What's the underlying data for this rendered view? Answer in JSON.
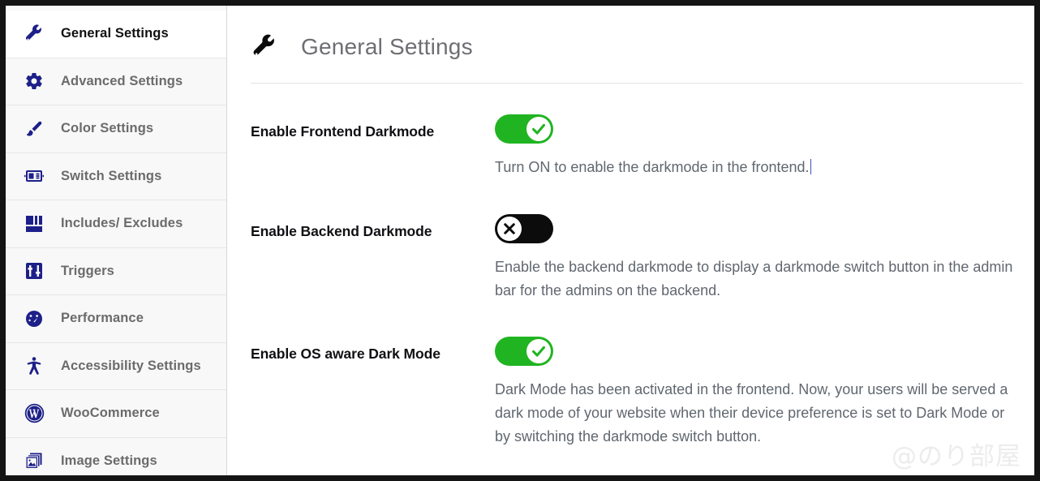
{
  "sidebar": {
    "items": [
      {
        "label": "General Settings",
        "icon": "wrench-icon",
        "active": true
      },
      {
        "label": "Advanced Settings",
        "icon": "gear-icon",
        "active": false
      },
      {
        "label": "Color Settings",
        "icon": "paintbrush-icon",
        "active": false
      },
      {
        "label": "Switch Settings",
        "icon": "switch-icon",
        "active": false
      },
      {
        "label": "Includes/ Excludes",
        "icon": "layout-blocks-icon",
        "active": false
      },
      {
        "label": "Triggers",
        "icon": "sliders-icon",
        "active": false
      },
      {
        "label": "Performance",
        "icon": "gauge-icon",
        "active": false
      },
      {
        "label": "Accessibility Settings",
        "icon": "accessibility-icon",
        "active": false
      },
      {
        "label": "WooCommerce",
        "icon": "wordpress-icon",
        "active": false
      },
      {
        "label": "Image Settings",
        "icon": "images-icon",
        "active": false
      }
    ]
  },
  "header": {
    "icon": "wrench-icon",
    "title": "General Settings"
  },
  "fields": [
    {
      "label": "Enable Frontend Darkmode",
      "toggle_state": "on",
      "toggle_glyph": "check-icon",
      "description": "Turn ON to enable the darkmode in the frontend.",
      "has_caret": true
    },
    {
      "label": "Enable Backend Darkmode",
      "toggle_state": "off",
      "toggle_glyph": "cross-icon",
      "description": "Enable the backend darkmode to display a darkmode switch button in the admin bar for the admins on the backend.",
      "has_caret": false
    },
    {
      "label": "Enable OS aware Dark Mode",
      "toggle_state": "on",
      "toggle_glyph": "check-icon",
      "description": "Dark Mode has been activated in the frontend. Now, your users will be served a dark mode of your website when their device preference is set to Dark Mode or by switching the darkmode switch button.",
      "has_caret": false
    }
  ],
  "watermark": {
    "text": "@のり部屋"
  },
  "colors": {
    "accent_blue": "#1d2088",
    "toggle_on": "#21b422",
    "toggle_off": "#0c0c0c",
    "label_text": "#101014",
    "desc_text": "#60676f",
    "nav_text": "#6b6b6b",
    "title_text": "#6e6e74"
  }
}
